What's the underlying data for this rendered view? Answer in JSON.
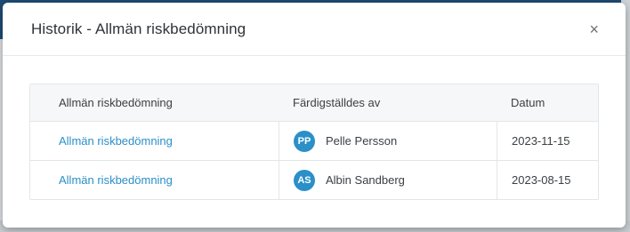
{
  "dialog": {
    "title": "Historik - Allmän riskbedömning",
    "close_label": "×"
  },
  "table": {
    "columns": [
      "Allmän riskbedömning",
      "Färdigställdes av",
      "Datum"
    ],
    "rows": [
      {
        "assessment": "Allmän riskbedömning",
        "initials": "PP",
        "name": "Pelle Persson",
        "date": "2023-11-15"
      },
      {
        "assessment": "Allmän riskbedömning",
        "initials": "AS",
        "name": "Albin Sandberg",
        "date": "2023-08-15"
      }
    ]
  },
  "colors": {
    "accent": "#2b8fc8",
    "header_bg": "#1f4d75"
  }
}
